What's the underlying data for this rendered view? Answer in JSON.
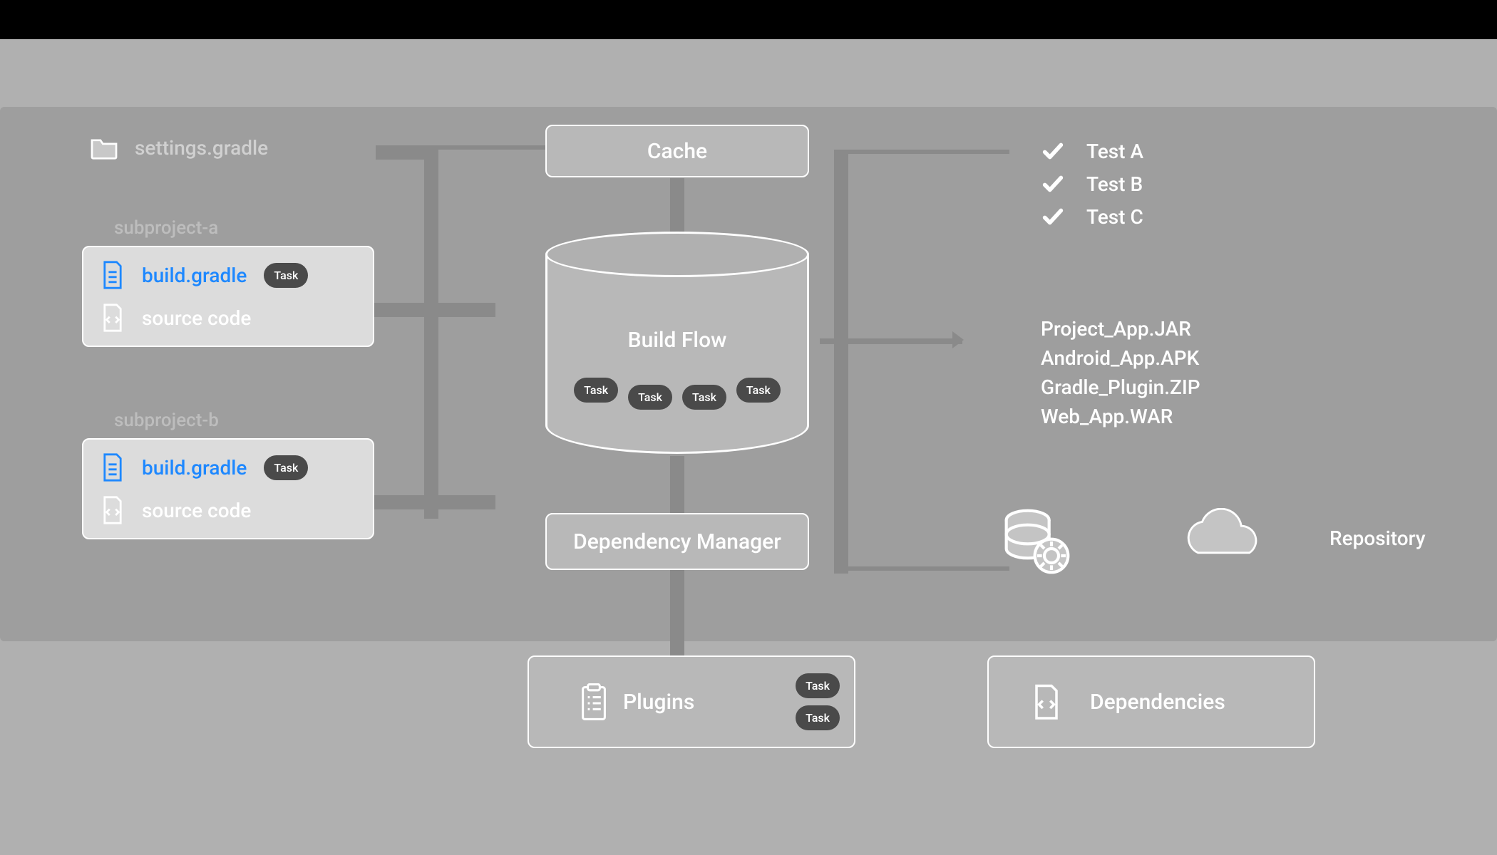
{
  "settings": {
    "label": "settings.gradle"
  },
  "subprojects": [
    {
      "label": "subproject-a",
      "build_file": "build.gradle",
      "source": "source code",
      "task": "Task"
    },
    {
      "label": "subproject-b",
      "build_file": "build.gradle",
      "source": "source code",
      "task": "Task"
    }
  ],
  "center": {
    "cache": "Cache",
    "build_flow": "Build Flow",
    "dep_manager": "Dependency Manager",
    "tasks": [
      "Task",
      "Task",
      "Task",
      "Task"
    ]
  },
  "tests": [
    "Test A",
    "Test B",
    "Test C"
  ],
  "artifacts": [
    "Project_App.JAR",
    "Android_App.APK",
    "Gradle_Plugin.ZIP",
    "Web_App.WAR"
  ],
  "repository": {
    "label": "Repository"
  },
  "plugins": {
    "label": "Plugins",
    "tasks": [
      "Task",
      "Task"
    ]
  },
  "dependencies": {
    "label": "Dependencies"
  }
}
